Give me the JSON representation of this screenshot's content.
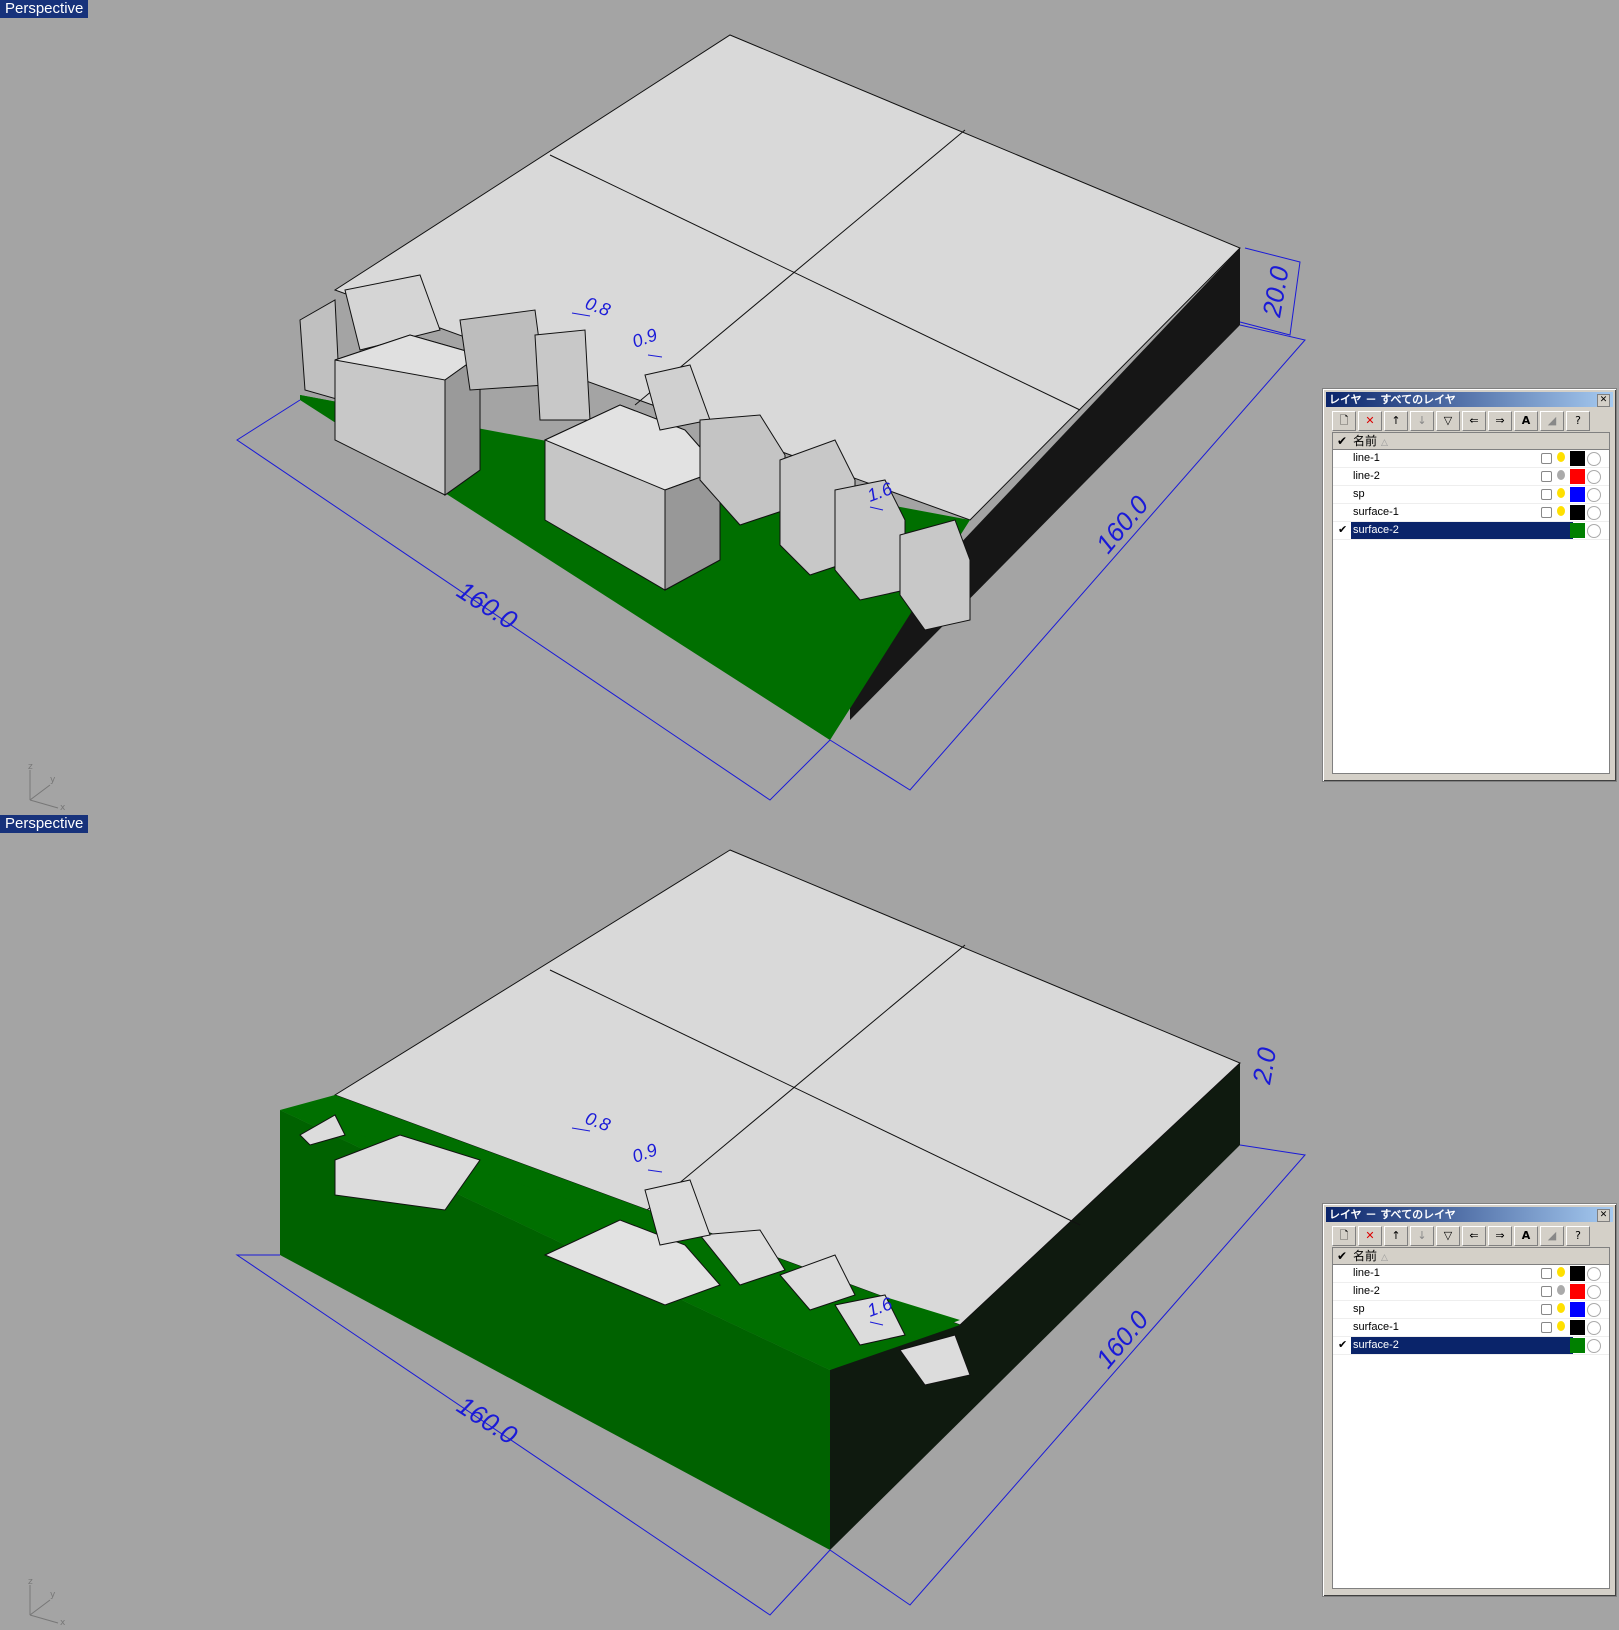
{
  "viewports": [
    {
      "label": "Perspective",
      "dimensions": {
        "front": "160.0",
        "side": "160.0",
        "height": "20.0",
        "small_a": "0.8",
        "small_b": "0.9",
        "small_c": "1.6"
      }
    },
    {
      "label": "Perspective",
      "dimensions": {
        "front": "160.0",
        "side": "160.0",
        "height": "2.0",
        "small_a": "0.8",
        "small_b": "0.9",
        "small_c": "1.6"
      }
    }
  ],
  "layer_panel": {
    "title": "レイヤ － すべてのレイヤ",
    "close_icon": "close-icon",
    "toolbar": [
      {
        "icon": "new-layer-icon",
        "glyph": "🗋"
      },
      {
        "icon": "delete-layer-icon",
        "glyph": "✕"
      },
      {
        "icon": "move-up-icon",
        "glyph": "↑"
      },
      {
        "icon": "move-down-icon",
        "glyph": "↓"
      },
      {
        "icon": "filter-icon",
        "glyph": "▽"
      },
      {
        "icon": "import-icon",
        "glyph": "⇐"
      },
      {
        "icon": "export-icon",
        "glyph": "⇒"
      },
      {
        "icon": "text-icon",
        "glyph": "A"
      },
      {
        "icon": "tool-icon",
        "glyph": "◢"
      },
      {
        "icon": "help-icon",
        "glyph": "?"
      }
    ],
    "header": {
      "check": "✔",
      "name": "名前",
      "sort": "△"
    },
    "layers": [
      {
        "name": "line-1",
        "color": "#000000",
        "current": ""
      },
      {
        "name": "line-2",
        "color": "#ff0000",
        "current": ""
      },
      {
        "name": "sp",
        "color": "#0000ff",
        "current": ""
      },
      {
        "name": "surface-1",
        "color": "#000000",
        "current": ""
      },
      {
        "name": "surface-2",
        "color": "#008000",
        "current": "✔"
      }
    ]
  },
  "colors": {
    "viewport_bg": "#a4a4a4",
    "ground": "#007000",
    "block": "#d8d8d8",
    "dim": "#1a1ad8",
    "label_bg": "#17327b"
  }
}
